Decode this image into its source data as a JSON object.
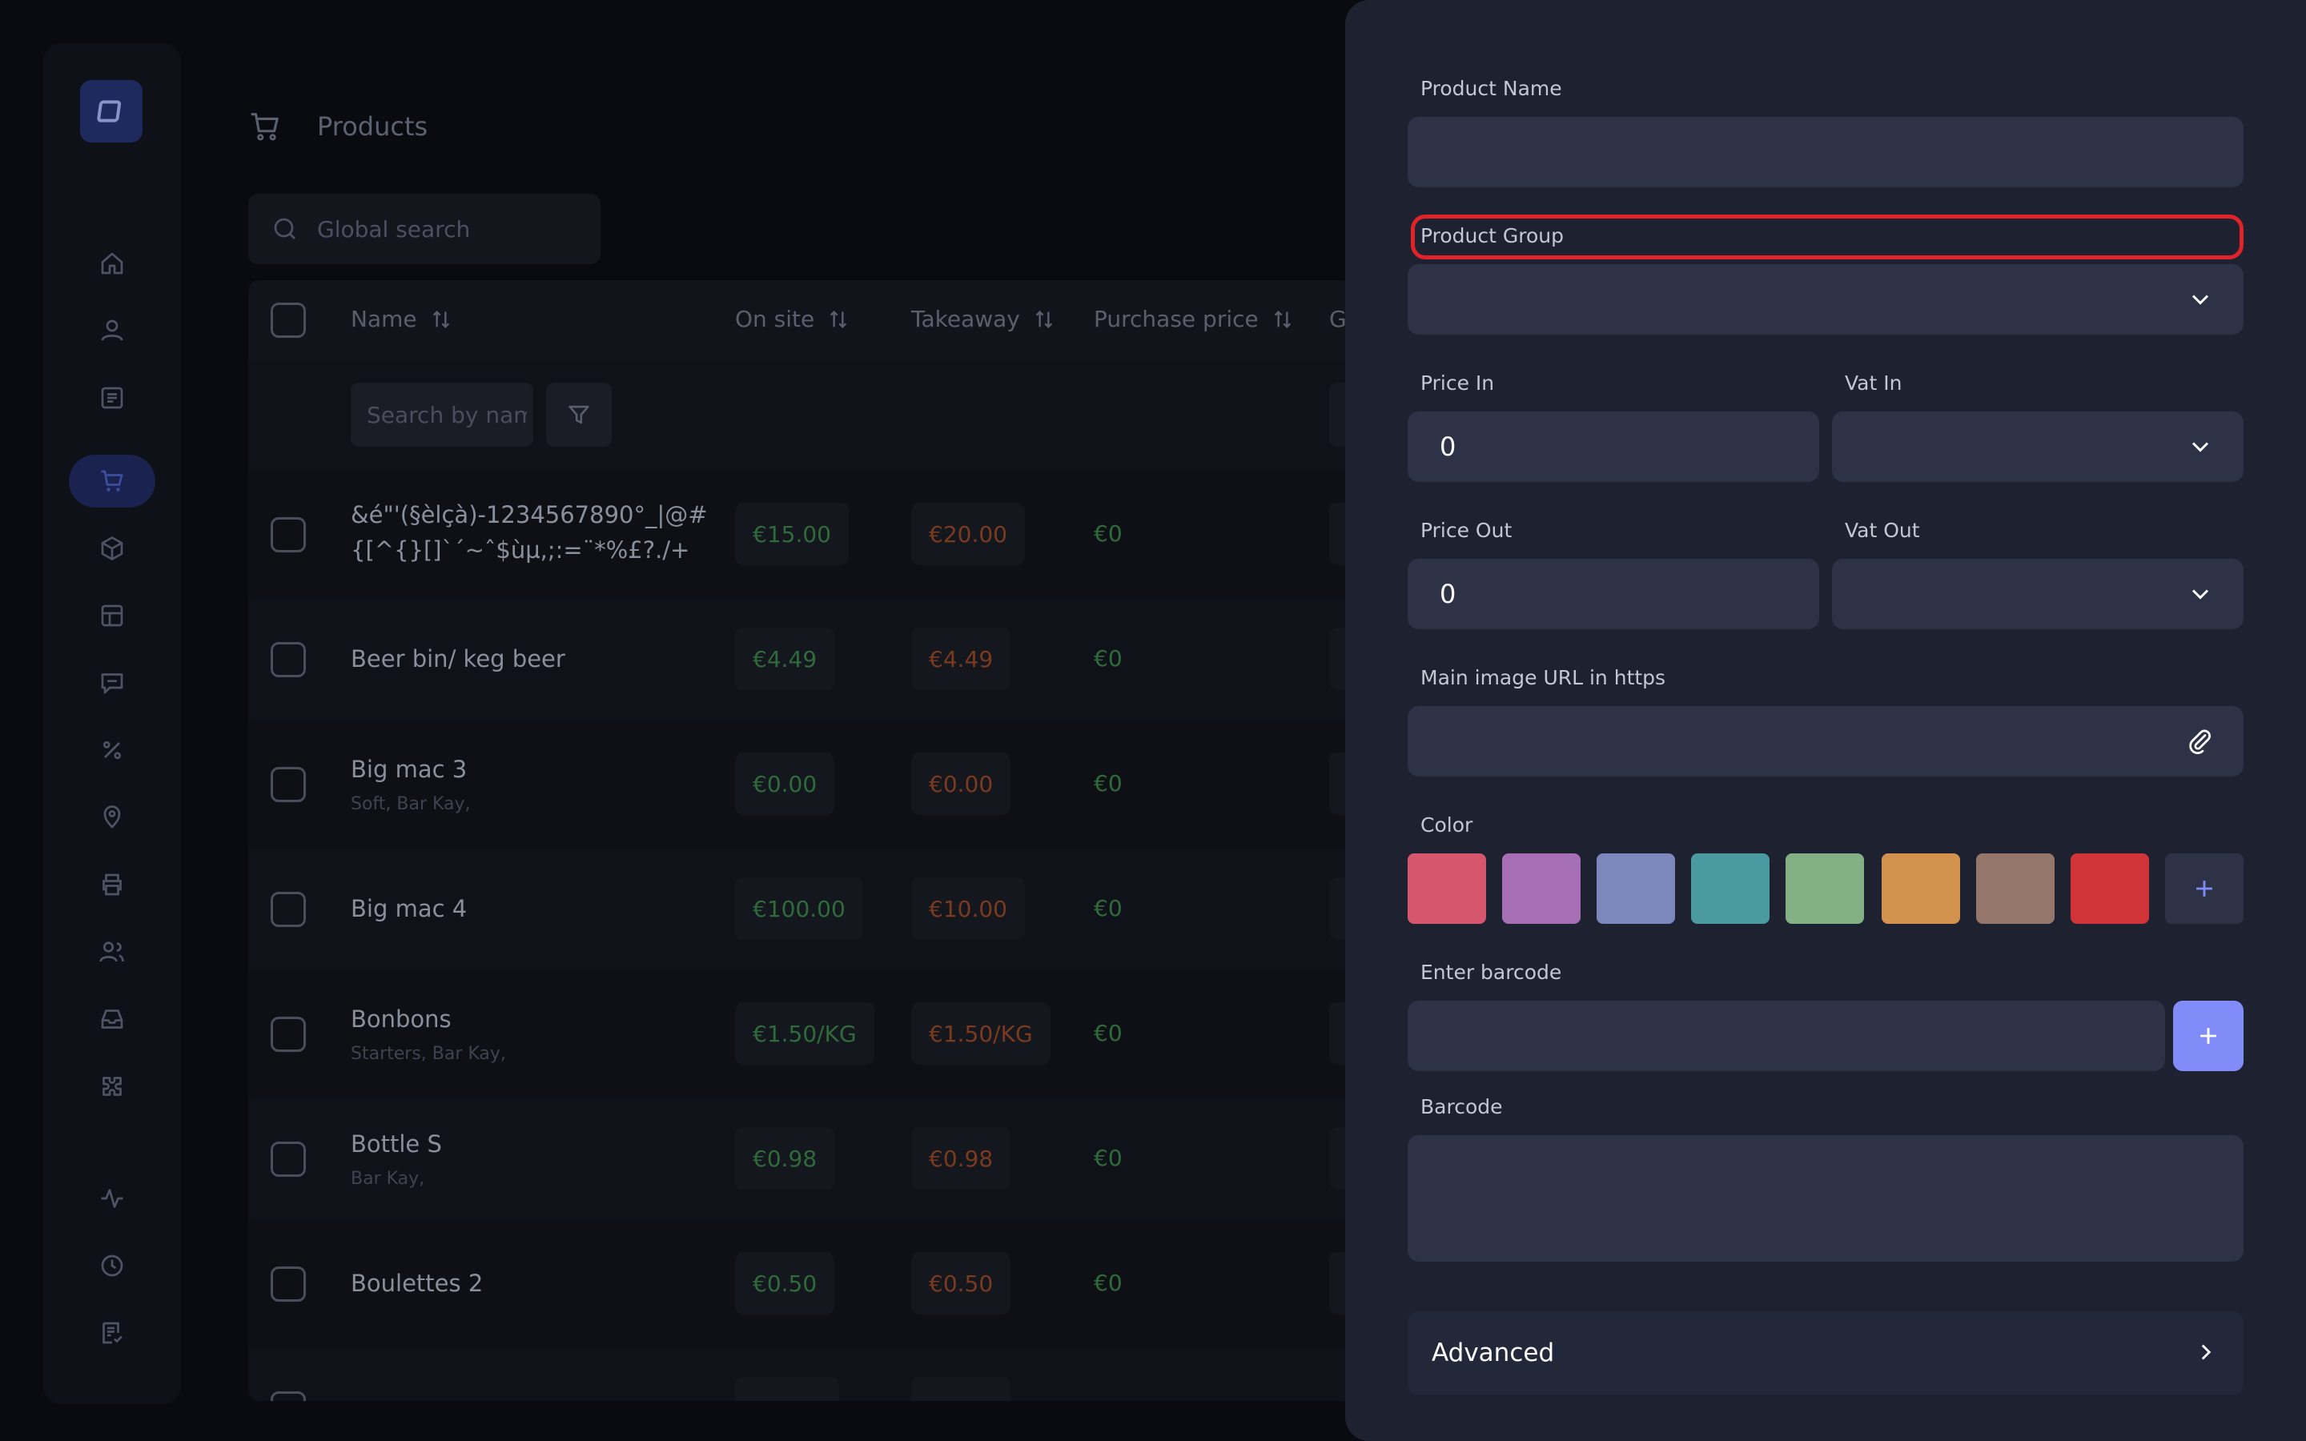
{
  "page": {
    "title": "Products"
  },
  "search": {
    "placeholder": "Global search",
    "name_placeholder": "Search by name"
  },
  "table": {
    "columns": [
      "Name",
      "On site",
      "Takeaway",
      "Purchase price",
      "G"
    ],
    "rows": [
      {
        "name": "&é\"'(§èlçà)-1234567890°_|@#",
        "name2": "{[^{}[]`´~ˆ$ùµ,;:=¨*%£?./+",
        "sub": "",
        "on_site": "€15.00",
        "takeaway": "€20.00",
        "purchase": "€0"
      },
      {
        "name": "Beer bin/ keg beer",
        "sub": "",
        "on_site": "€4.49",
        "takeaway": "€4.49",
        "purchase": "€0"
      },
      {
        "name": "Big mac 3",
        "sub": "Soft, Bar Kay,",
        "on_site": "€0.00",
        "takeaway": "€0.00",
        "purchase": "€0"
      },
      {
        "name": "Big mac 4",
        "sub": "",
        "on_site": "€100.00",
        "takeaway": "€10.00",
        "purchase": "€0"
      },
      {
        "name": "Bonbons",
        "sub": "Starters, Bar Kay,",
        "on_site": "€1.50/KG",
        "takeaway": "€1.50/KG",
        "purchase": "€0"
      },
      {
        "name": "Bottle S",
        "sub": "Bar Kay,",
        "on_site": "€0.98",
        "takeaway": "€0.98",
        "purchase": "€0"
      },
      {
        "name": "Boulettes 2",
        "sub": "",
        "on_site": "€0.50",
        "takeaway": "€0.50",
        "purchase": "€0"
      }
    ]
  },
  "drawer": {
    "product_name_label": "Product Name",
    "product_group_label": "Product Group",
    "price_in_label": "Price In",
    "price_in_value": "0",
    "vat_in_label": "Vat In",
    "price_out_label": "Price Out",
    "price_out_value": "0",
    "vat_out_label": "Vat Out",
    "image_url_label": "Main image URL in https",
    "color_label": "Color",
    "colors": [
      "#d5566d",
      "#a66fb5",
      "#7c87bb",
      "#4b9aa2",
      "#84b086",
      "#d4924f",
      "#94776a",
      "#d13438"
    ],
    "enter_barcode_label": "Enter barcode",
    "barcode_label": "Barcode",
    "advanced_label": "Advanced",
    "highlight_color": "#e12329",
    "accent_color": "#818cf8"
  },
  "icons": {
    "sidebar": [
      "home-icon",
      "user-icon",
      "list-icon",
      "cart-icon",
      "box-icon",
      "table-icon",
      "message-icon",
      "percent-icon",
      "location-icon",
      "printer-icon",
      "users-icon",
      "inbox-icon",
      "puzzle-icon",
      "activity-icon",
      "clock-icon",
      "checklist-icon"
    ]
  }
}
